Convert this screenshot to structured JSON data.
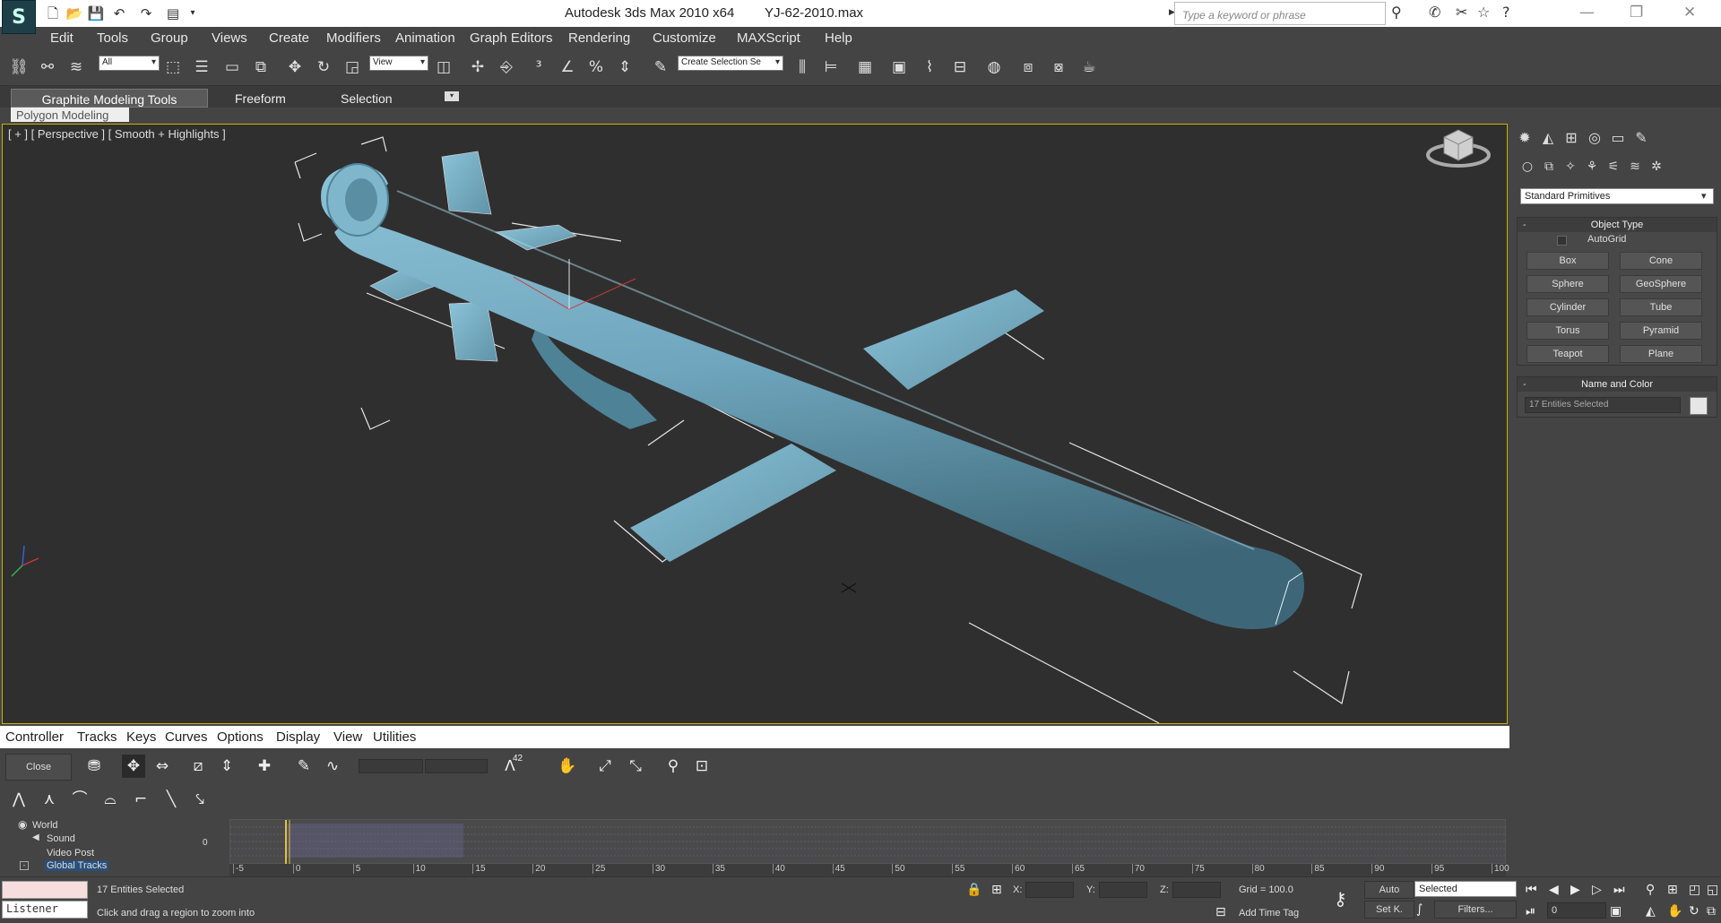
{
  "app": {
    "title": "Autodesk 3ds Max  2010 x64",
    "file": "YJ-62-2010.max",
    "logo": "3ds Max logo",
    "search_placeholder": "Type a keyword or phrase"
  },
  "menu": [
    "Edit",
    "Tools",
    "Group",
    "Views",
    "Create",
    "Modifiers",
    "Animation",
    "Graph Editors",
    "Rendering",
    "Customize",
    "MAXScript",
    "Help"
  ],
  "toolbar": {
    "filter_select": "All",
    "coord_select": "View",
    "named_selection": "Create Selection Se"
  },
  "ribbon": {
    "tabs": [
      "Graphite Modeling Tools",
      "Freeform",
      "Selection"
    ],
    "panel_label": "Polygon Modeling"
  },
  "viewport": {
    "label": "[ + ] [ Perspective ] [ Smooth + Highlights ]",
    "model_color": "#6fa6bd"
  },
  "command_panel": {
    "category": "Standard Primitives",
    "object_type_title": "Object Type",
    "autogrid_label": "AutoGrid",
    "buttons": [
      "Box",
      "Cone",
      "Sphere",
      "GeoSphere",
      "Cylinder",
      "Tube",
      "Torus",
      "Pyramid",
      "Teapot",
      "Plane"
    ],
    "name_color_title": "Name and Color",
    "name_value": "17 Entities Selected"
  },
  "curve_editor": {
    "menu": [
      "Controller",
      "Tracks",
      "Keys",
      "Curves",
      "Options",
      "Display",
      "View",
      "Utilities"
    ],
    "close_label": "Close",
    "counter": "42",
    "tree": [
      {
        "label": "World",
        "icon": "globe-icon"
      },
      {
        "label": "Sound",
        "icon": "speaker-icon"
      },
      {
        "label": "Video Post",
        "icon": ""
      },
      {
        "label": "Global Tracks",
        "icon": "",
        "selected": true
      }
    ],
    "key_zero": "0",
    "ruler_ticks": [
      "-5",
      "0",
      "5",
      "10",
      "15",
      "20",
      "25",
      "30",
      "35",
      "40",
      "45",
      "50",
      "55",
      "60",
      "65",
      "70",
      "75",
      "80",
      "85",
      "90",
      "95",
      "100"
    ]
  },
  "status": {
    "listener": "Listener",
    "selection_text": "17 Entities Selected",
    "prompt_text": "Click and drag a region to zoom into",
    "x_label": "X:",
    "y_label": "Y:",
    "z_label": "Z:",
    "grid": "Grid = 100.0",
    "add_time_tag": "Add Time Tag",
    "auto_label": "Auto",
    "setk_label": "Set K.",
    "key_mode": "Selected",
    "filters_label": "Filters...",
    "frame": "0"
  }
}
